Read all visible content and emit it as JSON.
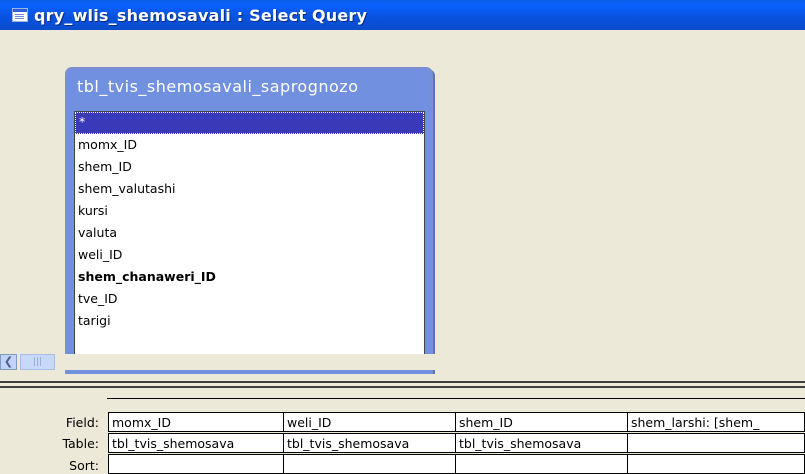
{
  "window": {
    "title": "qry_wlis_shemosavali : Select Query"
  },
  "table": {
    "title": "tbl_tvis_shemosavali_saprognozo",
    "fields": [
      {
        "label": "*",
        "selected": true,
        "bold": false
      },
      {
        "label": "momx_ID",
        "selected": false,
        "bold": false
      },
      {
        "label": "shem_ID",
        "selected": false,
        "bold": false
      },
      {
        "label": "shem_valutashi",
        "selected": false,
        "bold": false
      },
      {
        "label": "kursi",
        "selected": false,
        "bold": false
      },
      {
        "label": "valuta",
        "selected": false,
        "bold": false
      },
      {
        "label": "weli_ID",
        "selected": false,
        "bold": false
      },
      {
        "label": "shem_chanaweri_ID",
        "selected": false,
        "bold": true
      },
      {
        "label": "tve_ID",
        "selected": false,
        "bold": false
      },
      {
        "label": "tarigi",
        "selected": false,
        "bold": false
      }
    ]
  },
  "grid": {
    "row_labels": {
      "field": "Field:",
      "table": "Table:",
      "sort": "Sort:"
    },
    "columns": [
      {
        "field": "momx_ID",
        "table": "tbl_tvis_shemosava"
      },
      {
        "field": "weli_ID",
        "table": "tbl_tvis_shemosava"
      },
      {
        "field": "shem_ID",
        "table": "tbl_tvis_shemosava"
      },
      {
        "field": "shem_larshi: [shem_",
        "table": ""
      }
    ]
  },
  "icons": {
    "window_icon": "query-window-icon",
    "scroll_left": "scroll-left-arrow-icon",
    "scroll_thumb": "scroll-thumb-grip-icon"
  }
}
